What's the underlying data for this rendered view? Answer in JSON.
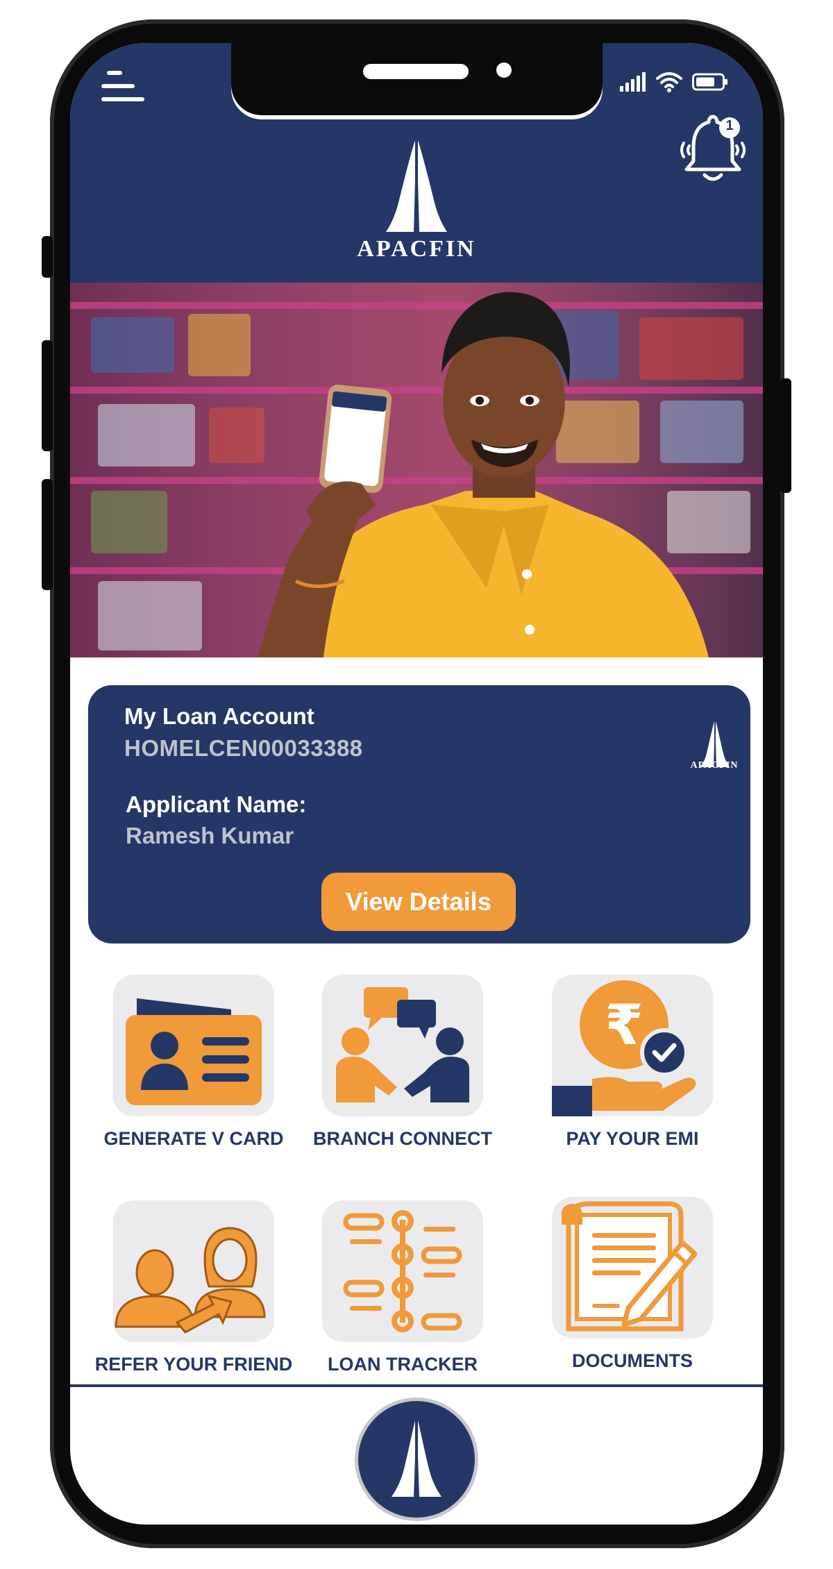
{
  "header": {
    "brand_name": "APACFIN",
    "notification_count": "1"
  },
  "loan_card": {
    "account_label": "My Loan Account",
    "account_number": "HOMELCEN00033388",
    "applicant_label": "Applicant Name:",
    "applicant_name": "Ramesh Kumar",
    "brand_name": "APACFIN",
    "view_button_label": "View Details"
  },
  "actions": [
    {
      "label": "GENERATE V CARD",
      "icon": "id-card-icon"
    },
    {
      "label": "BRANCH CONNECT",
      "icon": "branch-connect-icon"
    },
    {
      "label": "PAY YOUR EMI",
      "icon": "rupee-payment-icon"
    },
    {
      "label": "REFER YOUR FRIEND",
      "icon": "refer-friend-icon"
    },
    {
      "label": "LOAN TRACKER",
      "icon": "loan-tracker-icon"
    },
    {
      "label": "DOCUMENTS",
      "icon": "documents-icon"
    }
  ],
  "colors": {
    "primary": "#243766",
    "accent": "#f09a3a",
    "tile_bg": "#ebebed",
    "secondary_text": "#bfc3cd"
  }
}
